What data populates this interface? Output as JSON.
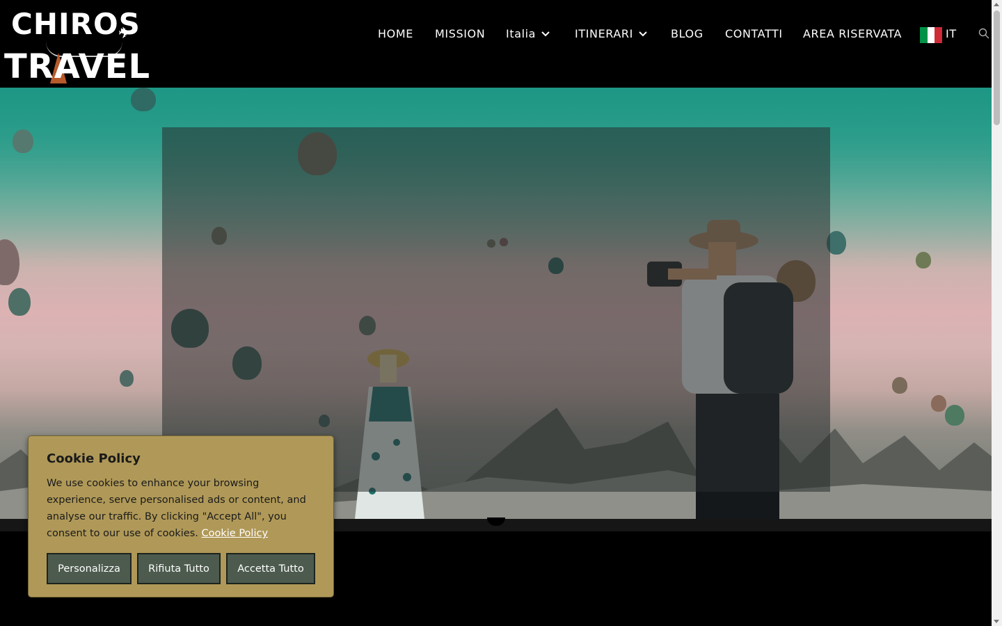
{
  "logo": {
    "line1": "CHIROS",
    "line2": "TRAVEL",
    "plane_icon": "airplane-icon"
  },
  "nav": {
    "items": [
      {
        "label": "HOME",
        "dropdown": false
      },
      {
        "label": "MISSION",
        "dropdown": false
      },
      {
        "label": "Italia",
        "dropdown": true
      },
      {
        "label": "ITINERARI",
        "dropdown": true
      },
      {
        "label": "BLOG",
        "dropdown": false
      },
      {
        "label": "CONTATTI",
        "dropdown": false
      },
      {
        "label": "AREA RISERVATA",
        "dropdown": false
      }
    ],
    "language": {
      "label": "IT",
      "flag_colors": [
        "#009246",
        "#ffffff",
        "#ce2b37"
      ]
    },
    "search_icon": "search-icon"
  },
  "cookie": {
    "title": "Cookie Policy",
    "text": "We use cookies to enhance your browsing experience, serve personalised ads or content, and analyse our traffic. By clicking \"Accept All\", you consent to our use of cookies.",
    "link": "Cookie Policy",
    "buttons": {
      "customize": "Personalizza",
      "reject": "Rifiuta Tutto",
      "accept": "Accetta Tutto"
    },
    "background": "#b09958",
    "button_color": "#4d5b4e"
  }
}
